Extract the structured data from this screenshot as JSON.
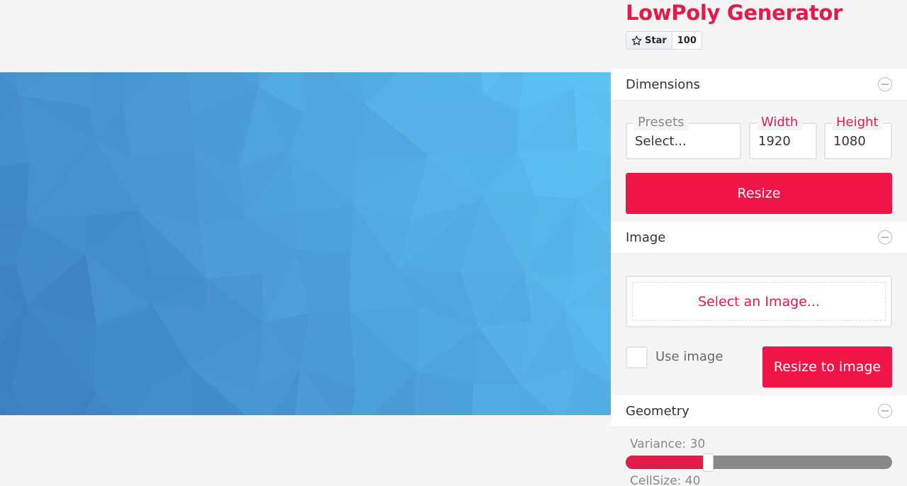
{
  "app": {
    "title": "LowPoly Generator",
    "brand_color": "#e21c48",
    "star_label": "Star",
    "star_count": "100"
  },
  "sections": {
    "dimensions": {
      "label": "Dimensions",
      "presets_label": "Presets",
      "presets_value": "Select...",
      "width_label": "Width",
      "width_value": "1920",
      "height_label": "Height",
      "height_value": "1080",
      "resize_label": "Resize"
    },
    "image": {
      "label": "Image",
      "select_label": "Select an Image...",
      "use_image_label": "Use image",
      "use_image_checked": false,
      "resize_to_image_label": "Resize to image"
    },
    "geometry": {
      "label": "Geometry",
      "variance_label": "Variance: 30",
      "variance_fraction": 0.3,
      "cellsize_label": "CellSize: 40"
    }
  },
  "canvas": {
    "gradient_from": "#3b7cbf",
    "gradient_to": "#5ec3f5"
  }
}
